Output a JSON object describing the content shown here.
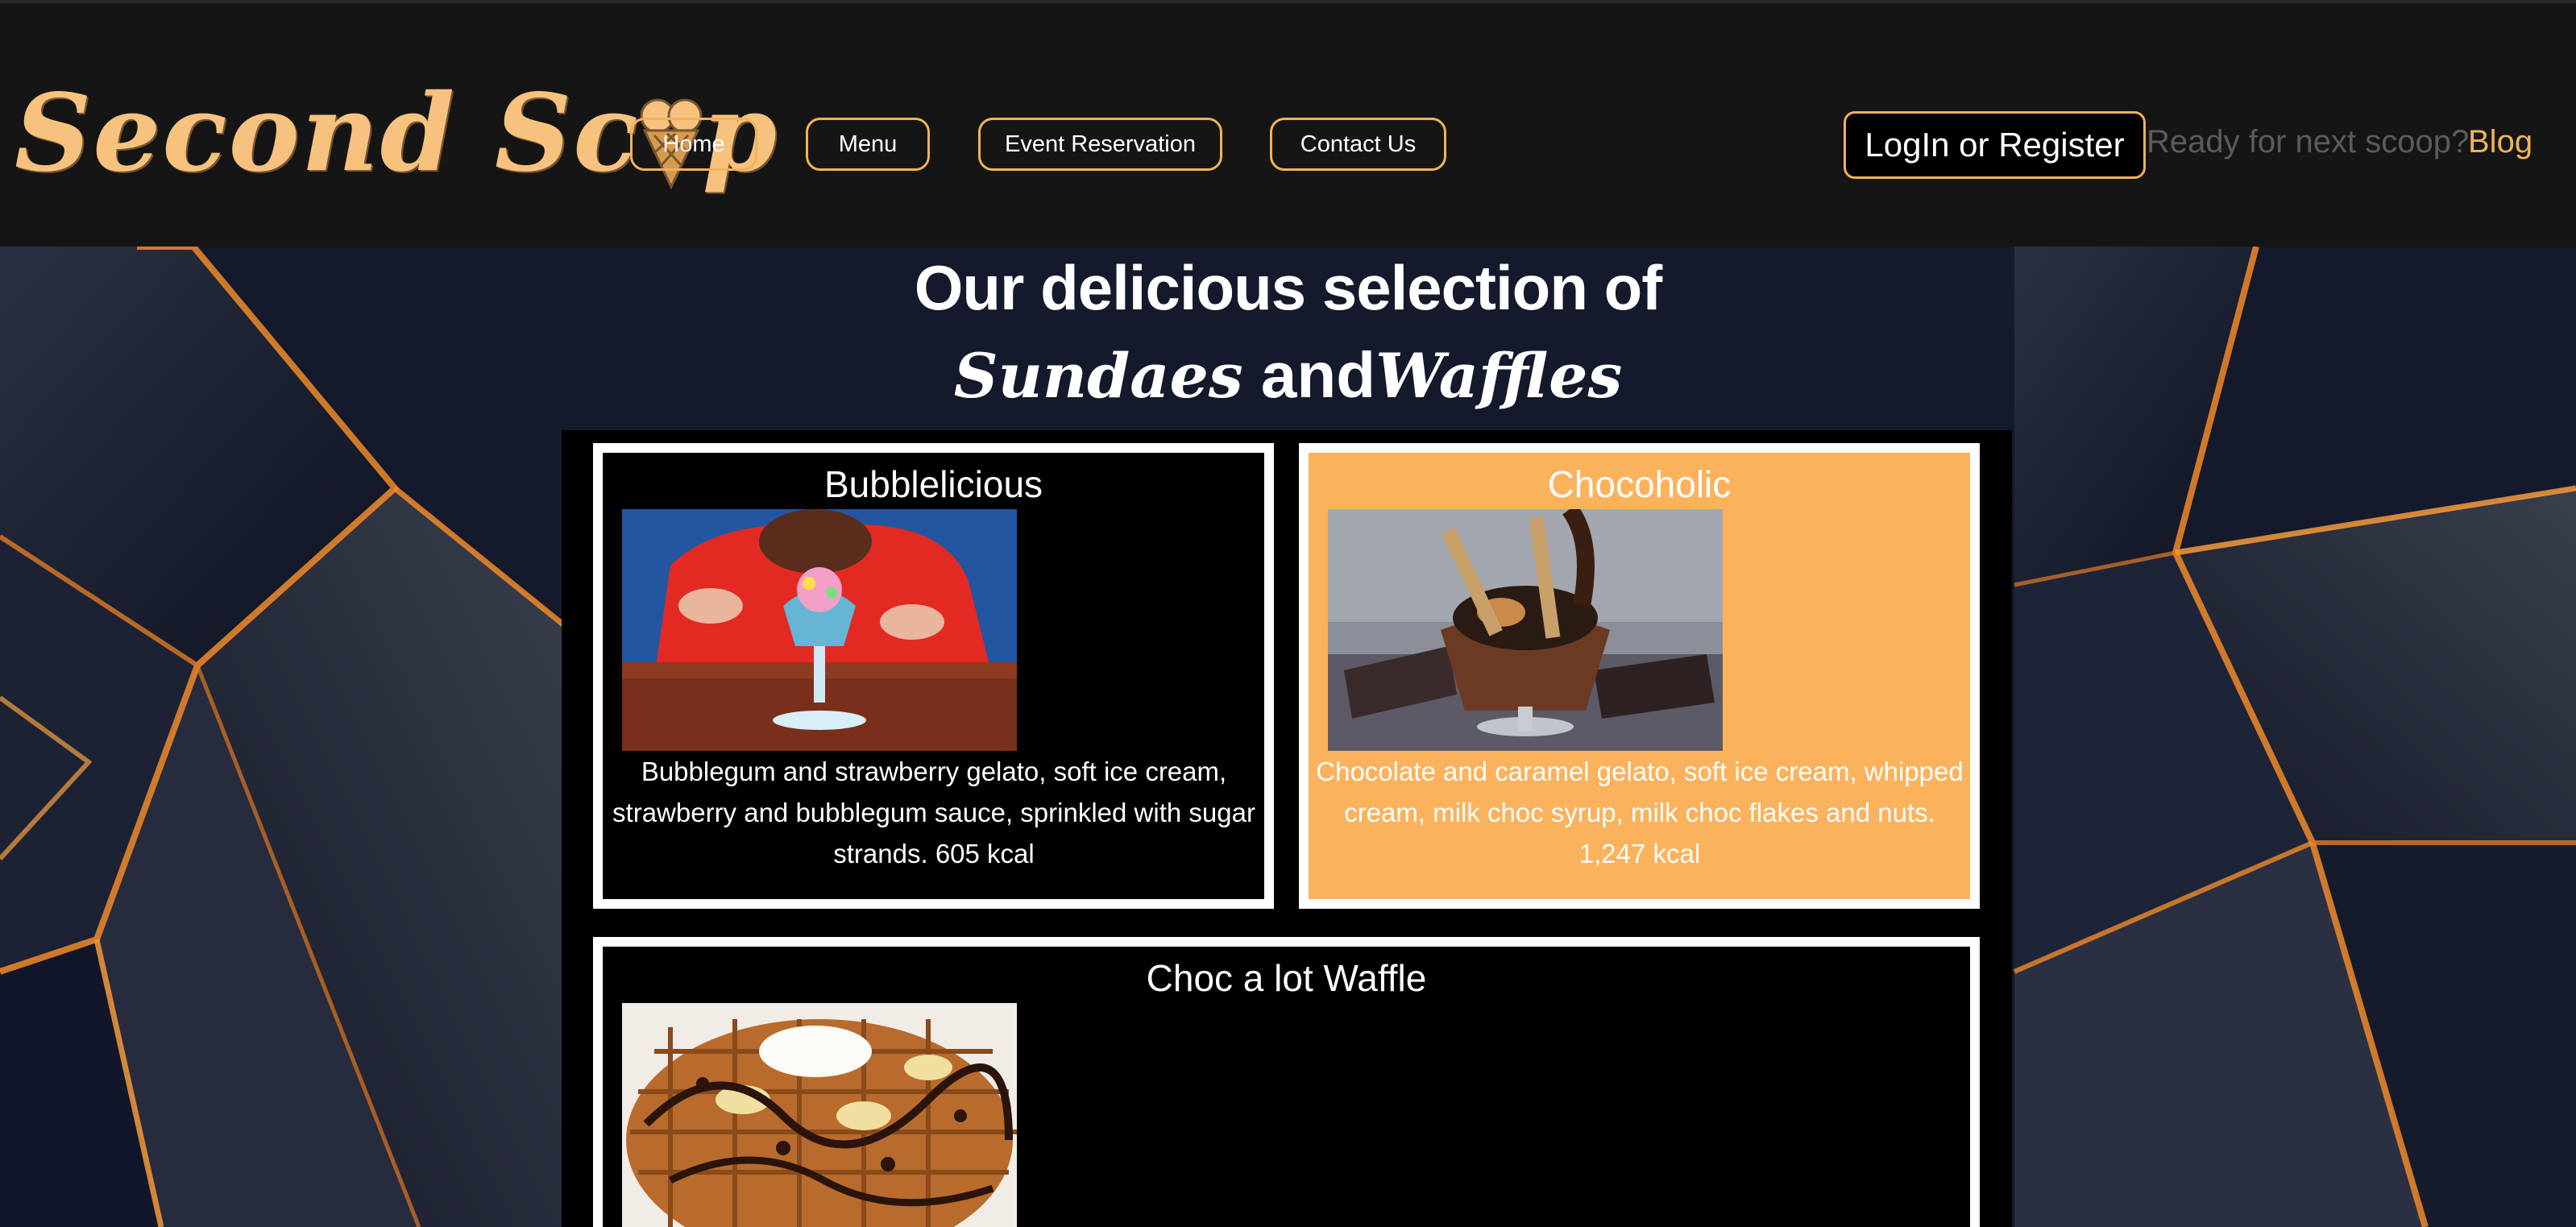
{
  "header": {
    "logo": {
      "before": "Second Sc",
      "after": "p"
    },
    "nav": [
      {
        "label": "Home"
      },
      {
        "label": "Menu"
      },
      {
        "label": "Event Reservation"
      },
      {
        "label": "Contact Us"
      }
    ],
    "login_label": "LogIn or Register",
    "tagline": "Ready for next scoop?",
    "blog_label": "Blog"
  },
  "hero": {
    "heading_line1": "Our delicious selection of",
    "heading_word1": "Sundaes",
    "heading_conj": " and",
    "heading_word2": "Waffles"
  },
  "cards": [
    {
      "title": "Bubblelicious",
      "description": "Bubblegum and strawberry gelato, soft ice cream, strawberry and bubblegum sauce, sprinkled with sugar strands. 605 kcal"
    },
    {
      "title": "Chocoholic",
      "description": "Chocolate and caramel gelato, soft ice cream, whipped cream, milk choc syrup, milk choc flakes and nuts. 1,247 kcal"
    },
    {
      "title": "Choc a lot Waffle"
    }
  ],
  "colors": {
    "accent": "#f0b25a",
    "logo": "#f6c27e",
    "card_highlight": "#fbb25c",
    "header_bg": "#161515",
    "tagline": "#5b5b5b"
  }
}
